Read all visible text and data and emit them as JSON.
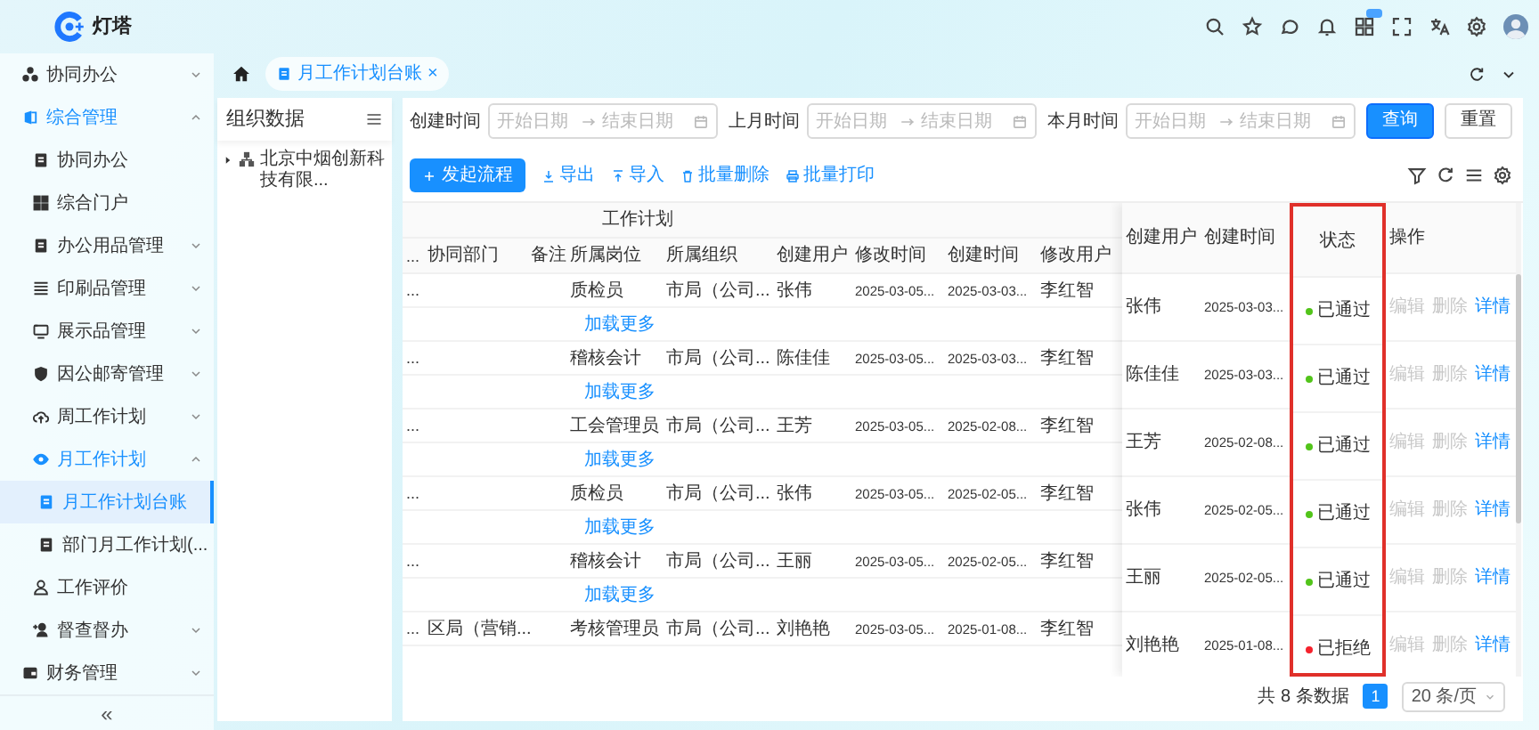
{
  "logo": {
    "text": "灯塔"
  },
  "sidebar": {
    "items": [
      {
        "label": "协同办公",
        "expanded": false,
        "selected": false
      },
      {
        "label": "综合管理",
        "expanded": true,
        "selected": false,
        "children": [
          {
            "label": "协同办公",
            "selected": false
          },
          {
            "label": "综合门户",
            "selected": false
          },
          {
            "label": "办公用品管理",
            "expanded": false,
            "selected": false
          },
          {
            "label": "印刷品管理",
            "expanded": false,
            "selected": false
          },
          {
            "label": "展示品管理",
            "expanded": false,
            "selected": false
          },
          {
            "label": "因公邮寄管理",
            "expanded": false,
            "selected": false
          },
          {
            "label": "周工作计划",
            "expanded": false,
            "selected": false
          },
          {
            "label": "月工作计划",
            "expanded": true,
            "selected": false,
            "children": [
              {
                "label": "月工作计划台账",
                "selected": true
              },
              {
                "label": "部门月工作计划(...",
                "selected": false
              }
            ]
          },
          {
            "label": "工作评价",
            "selected": false
          },
          {
            "label": "督查督办",
            "expanded": false,
            "selected": false
          }
        ]
      },
      {
        "label": "财务管理",
        "expanded": false,
        "selected": false
      }
    ],
    "collapse": "«"
  },
  "tabs": [
    {
      "label": "月工作计划台账",
      "selected": true,
      "close": "×"
    }
  ],
  "org_panel": {
    "title": "组织数据",
    "tree": [
      {
        "label": "北京中烟创新科技有限...",
        "expanded": false
      }
    ]
  },
  "filters": [
    {
      "label": "创建时间",
      "start_placeholder": "开始日期",
      "end_placeholder": "结束日期"
    },
    {
      "label": "上月时间",
      "start_placeholder": "开始日期",
      "end_placeholder": "结束日期"
    },
    {
      "label": "本月时间",
      "start_placeholder": "开始日期",
      "end_placeholder": "结束日期"
    }
  ],
  "filter_buttons": [
    {
      "label": "查询",
      "kind": "primary"
    },
    {
      "label": "重置",
      "kind": "default"
    }
  ],
  "toolbar": {
    "primary": "发起流程",
    "actions": [
      {
        "label": "导出"
      },
      {
        "label": "导入"
      },
      {
        "label": "批量删除"
      },
      {
        "label": "批量打印"
      }
    ]
  },
  "table": {
    "group_header": "工作计划",
    "columns": [
      "...",
      "协同部门",
      "备注",
      "所属岗位",
      "所属组织",
      "创建用户",
      "修改时间",
      "创建时间",
      "修改用户"
    ],
    "rows": [
      {
        "cells": [
          "...",
          null,
          null,
          "质检员",
          "市局（公司...",
          "张伟",
          "2025-03-05...",
          "2025-03-03...",
          "李红智"
        ],
        "more": "加载更多"
      },
      {
        "cells": [
          "...",
          null,
          null,
          "稽核会计",
          "市局（公司...",
          "陈佳佳",
          "2025-03-05...",
          "2025-03-03...",
          "李红智"
        ],
        "more": "加载更多"
      },
      {
        "cells": [
          "...",
          null,
          null,
          "工会管理员",
          "市局（公司...",
          "王芳",
          "2025-03-05...",
          "2025-02-08...",
          "李红智"
        ],
        "more": "加载更多"
      },
      {
        "cells": [
          "...",
          null,
          null,
          "质检员",
          "市局（公司...",
          "张伟",
          "2025-03-05...",
          "2025-02-05...",
          "李红智"
        ],
        "more": "加载更多"
      },
      {
        "cells": [
          "...",
          null,
          null,
          "稽核会计",
          "市局（公司...",
          "王丽",
          "2025-03-05...",
          "2025-02-05...",
          "李红智"
        ],
        "more": "加载更多"
      },
      {
        "cells": [
          "...",
          "区局（营销...",
          null,
          "考核管理员",
          "市局（公司...",
          "刘艳艳",
          "2025-03-05...",
          "2025-01-08...",
          "李红智"
        ]
      }
    ],
    "fixed_columns": [
      {
        "label": "创建用户",
        "highlighted": false
      },
      {
        "label": "创建时间",
        "highlighted": false
      },
      {
        "label": "状态",
        "highlighted": true
      },
      {
        "label": "操作",
        "highlighted": false
      }
    ],
    "fixed_rows": [
      {
        "creator": "张伟",
        "created": "2025-03-03...",
        "status": {
          "text": "已通过",
          "color": "#52c41a"
        },
        "actions": [
          {
            "label": "编辑",
            "disabled": true
          },
          {
            "label": "删除",
            "disabled": true
          },
          {
            "label": "详情",
            "disabled": false
          }
        ]
      },
      {
        "creator": "陈佳佳",
        "created": "2025-03-03...",
        "status": {
          "text": "已通过",
          "color": "#52c41a"
        },
        "actions": [
          {
            "label": "编辑",
            "disabled": true
          },
          {
            "label": "删除",
            "disabled": true
          },
          {
            "label": "详情",
            "disabled": false
          }
        ]
      },
      {
        "creator": "王芳",
        "created": "2025-02-08...",
        "status": {
          "text": "已通过",
          "color": "#52c41a"
        },
        "actions": [
          {
            "label": "编辑",
            "disabled": true
          },
          {
            "label": "删除",
            "disabled": true
          },
          {
            "label": "详情",
            "disabled": false
          }
        ]
      },
      {
        "creator": "张伟",
        "created": "2025-02-05...",
        "status": {
          "text": "已通过",
          "color": "#52c41a"
        },
        "actions": [
          {
            "label": "编辑",
            "disabled": true
          },
          {
            "label": "删除",
            "disabled": true
          },
          {
            "label": "详情",
            "disabled": false
          }
        ]
      },
      {
        "creator": "王丽",
        "created": "2025-02-05...",
        "status": {
          "text": "已通过",
          "color": "#52c41a"
        },
        "actions": [
          {
            "label": "编辑",
            "disabled": true
          },
          {
            "label": "删除",
            "disabled": true
          },
          {
            "label": "详情",
            "disabled": false
          }
        ]
      },
      {
        "creator": "刘艳艳",
        "created": "2025-01-08...",
        "status": {
          "text": "已拒绝",
          "color": "#f5222d"
        },
        "actions": [
          {
            "label": "编辑",
            "disabled": true
          },
          {
            "label": "删除",
            "disabled": true
          },
          {
            "label": "详情",
            "disabled": false
          }
        ]
      }
    ]
  },
  "pagination": {
    "total": "共 8 条数据",
    "pages": [
      {
        "label": "1",
        "selected": true
      }
    ],
    "page_size": "20 条/页"
  }
}
